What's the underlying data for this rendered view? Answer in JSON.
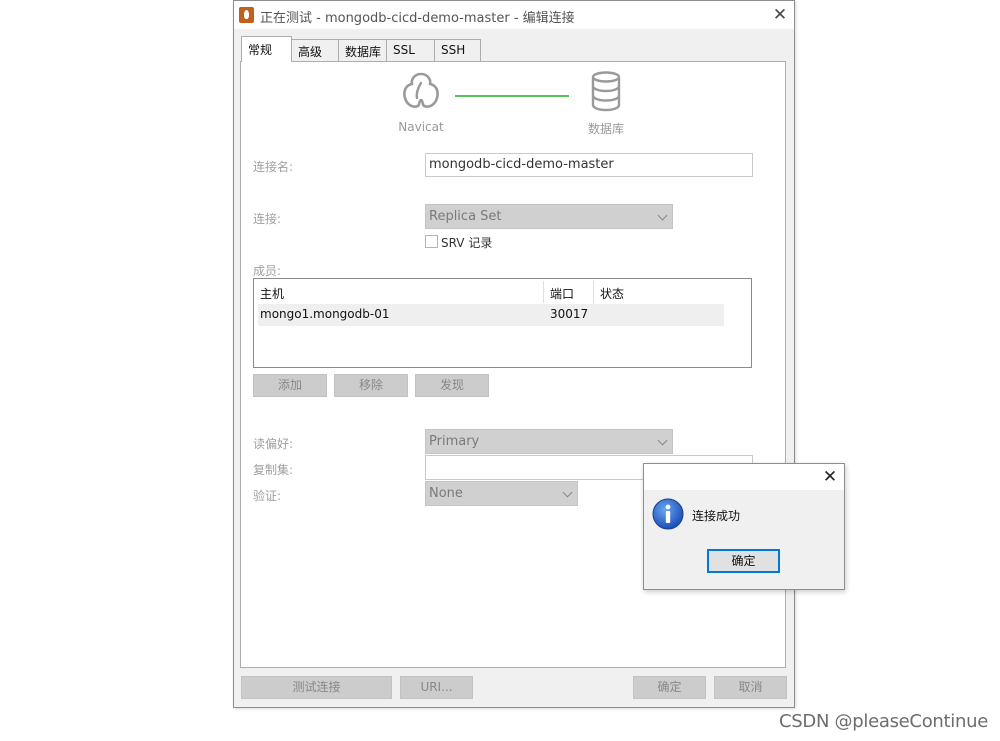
{
  "window": {
    "title": "正在测试 - mongodb-cicd-demo-master - 编辑连接",
    "close_symbol": "✕"
  },
  "tabs": [
    {
      "label": "常规",
      "active": true
    },
    {
      "label": "高级",
      "active": false
    },
    {
      "label": "数据库",
      "active": false
    },
    {
      "label": "SSL",
      "active": false
    },
    {
      "label": "SSH",
      "active": false
    }
  ],
  "illustration": {
    "navicat_label": "Navicat",
    "database_label": "数据库",
    "connection_line_color": "#54c35b"
  },
  "form": {
    "connection_name_label": "连接名:",
    "connection_name_value": "mongodb-cicd-demo-master",
    "connection_label": "连接:",
    "connection_value": "Replica Set",
    "srv_label": "SRV 记录",
    "srv_checked": false,
    "members_label": "成员:",
    "read_pref_label": "读偏好:",
    "read_pref_value": "Primary",
    "replica_set_label": "复制集:",
    "replica_set_value": "",
    "auth_label": "验证:",
    "auth_value": "None"
  },
  "members_table": {
    "columns": [
      "主机",
      "端口",
      "状态"
    ],
    "rows": [
      {
        "host": "mongo1.mongodb-01",
        "port": "30017",
        "status": ""
      }
    ]
  },
  "member_buttons": {
    "add": "添加",
    "remove": "移除",
    "discover": "发现"
  },
  "footer_buttons": {
    "test": "测试连接",
    "uri": "URI...",
    "ok": "确定",
    "cancel": "取消"
  },
  "message_box": {
    "close_symbol": "✕",
    "text": "连接成功",
    "ok": "确定",
    "icon": "info-icon"
  },
  "watermark": "CSDN @pleaseContinue"
}
